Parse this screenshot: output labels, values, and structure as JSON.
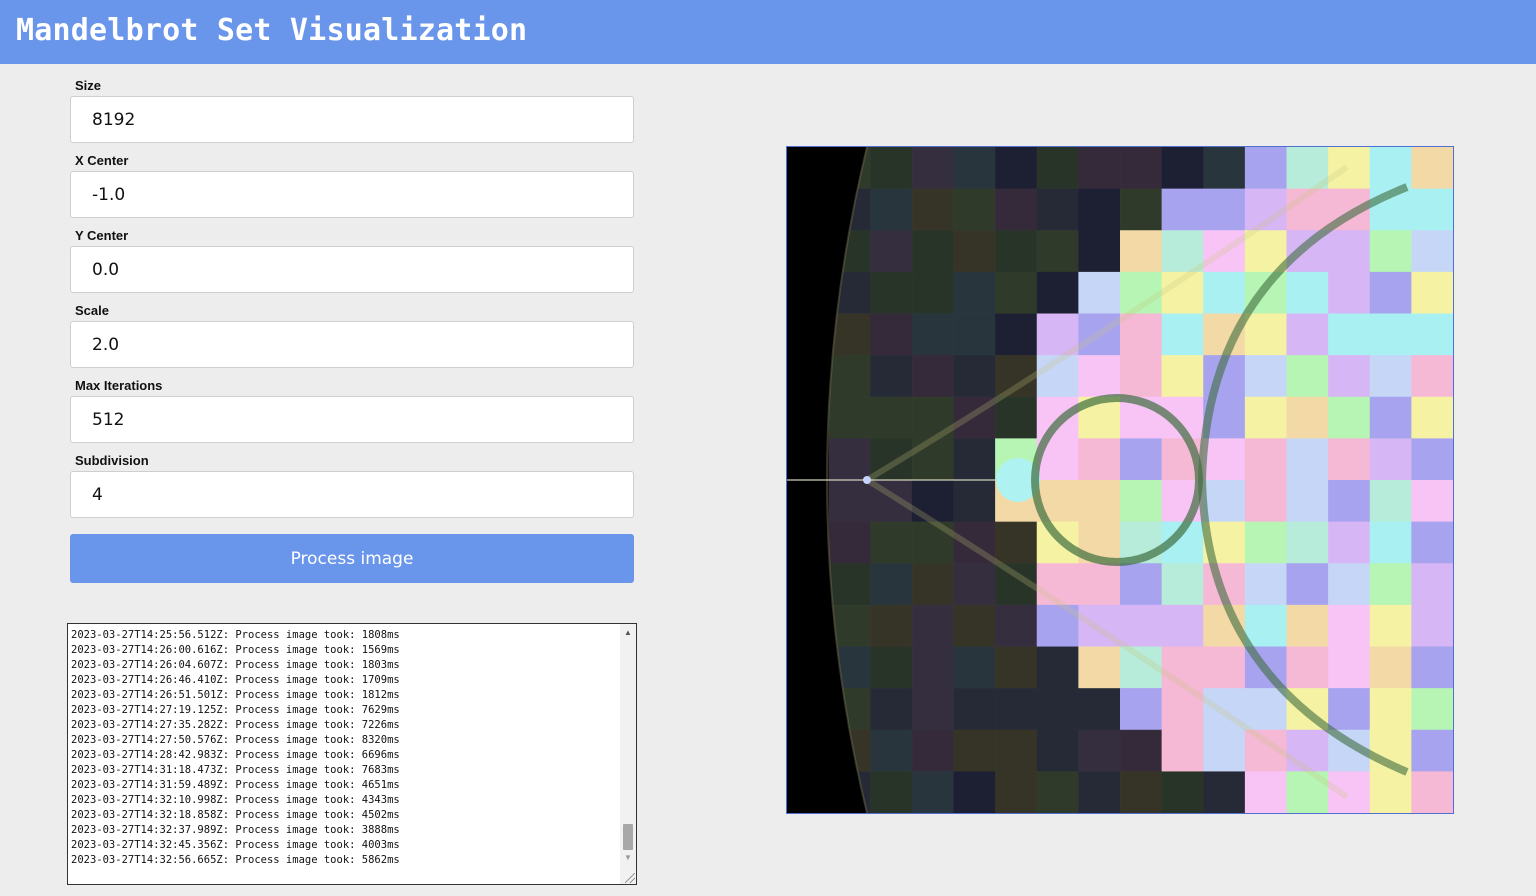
{
  "app": {
    "title": "Mandelbrot Set Visualization"
  },
  "form": {
    "size": {
      "label": "Size",
      "value": "8192"
    },
    "x_center": {
      "label": "X Center",
      "value": "-1.0"
    },
    "y_center": {
      "label": "Y Center",
      "value": "0.0"
    },
    "scale": {
      "label": "Scale",
      "value": "2.0"
    },
    "max_iterations": {
      "label": "Max Iterations",
      "value": "512"
    },
    "subdivision": {
      "label": "Subdivision",
      "value": "4"
    },
    "process_label": "Process image"
  },
  "log": {
    "lines": [
      "2023-03-27T14:25:56.512Z: Process image took: 1808ms",
      "2023-03-27T14:26:00.616Z: Process image took: 1569ms",
      "2023-03-27T14:26:04.607Z: Process image took: 1803ms",
      "2023-03-27T14:26:46.410Z: Process image took: 1709ms",
      "2023-03-27T14:26:51.501Z: Process image took: 1812ms",
      "2023-03-27T14:27:19.125Z: Process image took: 7629ms",
      "2023-03-27T14:27:35.282Z: Process image took: 7226ms",
      "2023-03-27T14:27:50.576Z: Process image took: 8320ms",
      "2023-03-27T14:28:42.983Z: Process image took: 6696ms",
      "2023-03-27T14:31:18.473Z: Process image took: 7683ms",
      "2023-03-27T14:31:59.489Z: Process image took: 4651ms",
      "2023-03-27T14:32:10.998Z: Process image took: 4343ms",
      "2023-03-27T14:32:18.858Z: Process image took: 4502ms",
      "2023-03-27T14:32:37.989Z: Process image took: 3888ms",
      "2023-03-27T14:32:45.356Z: Process image took: 4003ms",
      "2023-03-27T14:32:56.665Z: Process image took: 5862ms"
    ]
  },
  "colors": {
    "accent": "#6995ea",
    "background": "#ededed",
    "canvas_border": "#4f6fd1"
  },
  "icons": {
    "scroll_up": "▲",
    "scroll_down": "▼"
  }
}
